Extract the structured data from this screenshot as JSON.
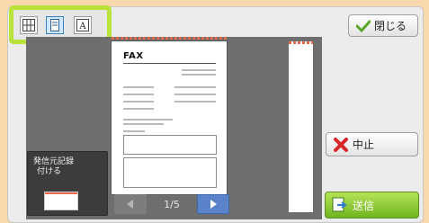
{
  "toolbar": {
    "view_buttons": [
      {
        "name": "thumbnail-grid-view",
        "icon": "grid-icon"
      },
      {
        "name": "page-view",
        "icon": "page-icon"
      },
      {
        "name": "text-view",
        "icon": "text-a-icon"
      }
    ],
    "close_label": "閉じる",
    "close_icon": "checkmark-icon"
  },
  "preview": {
    "document_title": "FAX",
    "current_page": "1/5"
  },
  "side_panel": {
    "label_line1": "発信元記録",
    "label_line2": "付ける"
  },
  "actions": {
    "stop_label": "中止",
    "stop_icon": "red-x-icon",
    "send_label": "送信",
    "send_icon": "send-document-icon"
  },
  "colors": {
    "highlight": "#b9e23a",
    "background": "#f8d9ad",
    "send_green": "#6fb51f",
    "next_blue": "#5b83c9"
  }
}
